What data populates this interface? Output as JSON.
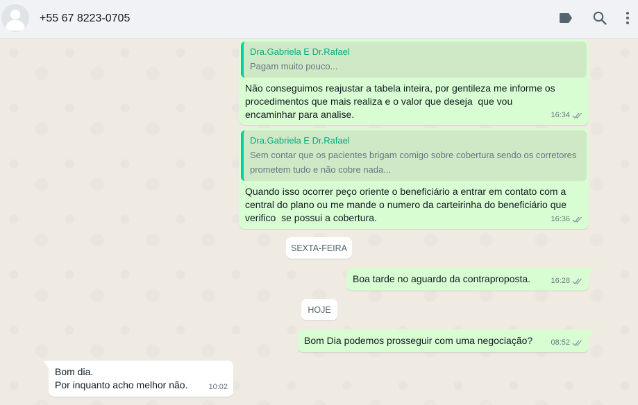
{
  "header": {
    "contact_name": "+55 67 8223-0705",
    "icons": [
      "label-icon",
      "search-icon",
      "menu-icon"
    ]
  },
  "messages": [
    {
      "direction": "out",
      "quote": {
        "author": "Dra.Gabriela E Dr.Rafael",
        "text": "Pagam muito pouco..."
      },
      "text": "Não conseguimos reajustar a tabela inteira, por gentileza me informe os procedimentos que mais realiza e o valor que deseja  que vou encaminhar para analise.",
      "time": "16:34",
      "status": "delivered"
    },
    {
      "direction": "out",
      "quote": {
        "author": "Dra.Gabriela E Dr.Rafael",
        "text": "Sem contar que os pacientes brigam comigo sobre cobertura sendo os corretores prometem tudo e não cobre nada..."
      },
      "text": "Quando isso ocorrer peço oriente o beneficiário a entrar em contato com a central do plano ou me mande o numero da carteirinha do beneficiário que verifico  se possui a cobertura.",
      "time": "16:36",
      "status": "delivered"
    },
    {
      "type": "date",
      "label": "SEXTA-FEIRA"
    },
    {
      "direction": "out",
      "text": "Boa tarde no aguardo da contraproposta.",
      "time": "16:28",
      "status": "delivered"
    },
    {
      "type": "date",
      "label": "HOJE"
    },
    {
      "direction": "out",
      "text": "Bom Dia podemos prosseguir com uma negociação?",
      "time": "08:52",
      "status": "delivered"
    },
    {
      "direction": "in",
      "text": "Bom dia.\nPor inquanto acho melhor não.",
      "time": "10:02"
    }
  ],
  "colors": {
    "header_bg": "#f0f2f5",
    "chat_bg": "#efeae2",
    "outgoing_bubble": "#d9fdd3",
    "incoming_bubble": "#ffffff",
    "quote_accent": "#06cf9c"
  }
}
